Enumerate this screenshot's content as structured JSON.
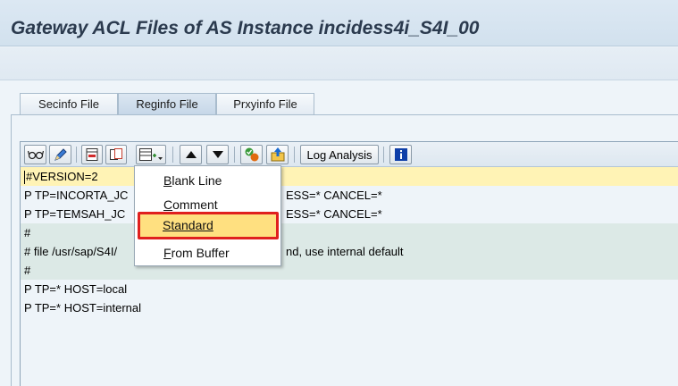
{
  "window": {
    "title": "Gateway ACL Files of AS Instance incidess4i_S4I_00"
  },
  "tabs": [
    {
      "label": "Secinfo File",
      "active": false
    },
    {
      "label": "Reginfo File",
      "active": true
    },
    {
      "label": "Prxyinfo File",
      "active": false
    }
  ],
  "editor_toolbar": {
    "buttons": [
      {
        "icon": "glasses-display-icon"
      },
      {
        "icon": "pencil-change-icon"
      },
      {
        "icon": "delete-line-icon"
      },
      {
        "icon": "copy-line-icon"
      },
      {
        "icon": "insert-line-menu-icon"
      },
      {
        "icon": "move-up-icon"
      },
      {
        "icon": "move-down-icon"
      },
      {
        "icon": "check-status-icon"
      },
      {
        "icon": "upload-icon"
      },
      {
        "icon": "info-icon"
      }
    ],
    "log_analysis_label": "Log Analysis",
    "accent_color": "#0f3fa8"
  },
  "lines": [
    {
      "text": "#VERSION=2",
      "style": "yellow"
    },
    {
      "text": "P TP=INCORTA_JC",
      "suffix": "ESS=* CANCEL=*",
      "style": "plain"
    },
    {
      "text": "P TP=TEMSAH_JC",
      "suffix": "ESS=* CANCEL=*",
      "style": "plain"
    },
    {
      "text": "#",
      "style": "teal"
    },
    {
      "text": "# file /usr/sap/S4I/",
      "suffix": "nd, use internal default",
      "style": "teal"
    },
    {
      "text": "#",
      "style": "teal"
    },
    {
      "text": "P TP=* HOST=local",
      "style": "plain"
    },
    {
      "text": "P TP=* HOST=internal",
      "style": "plain"
    }
  ],
  "insert_menu": {
    "items": [
      {
        "first": "B",
        "rest": "lank Line",
        "selected": false
      },
      {
        "first": "C",
        "rest": "omment",
        "selected": false
      },
      {
        "first": "S",
        "rest": "tandard",
        "selected": true
      },
      {
        "first": "F",
        "rest": "rom Buffer",
        "selected": false
      }
    ],
    "highlight_color": "#ffe080",
    "border_color": "#e0201e"
  }
}
